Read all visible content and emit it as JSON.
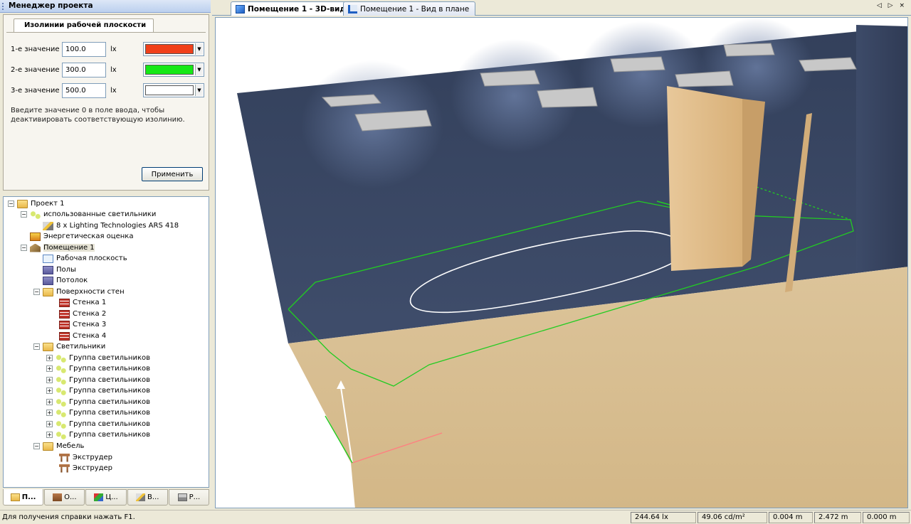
{
  "project_manager": {
    "title": "Менеджер проекта",
    "isolines_tab": "Изолинии рабочей плоскости",
    "rows": [
      {
        "label": "1-е значение",
        "value": "100.0",
        "unit": "lx",
        "color": "#f0401a"
      },
      {
        "label": "2-е значение",
        "value": "300.0",
        "unit": "lx",
        "color": "#16e816"
      },
      {
        "label": "3-е значение",
        "value": "500.0",
        "unit": "lx",
        "color": "#ffffff"
      }
    ],
    "note": "Введите значение 0 в поле ввода, чтобы деактивировать соответствующую изолинию.",
    "apply_label": "Применить"
  },
  "tree": {
    "project": "Проект 1",
    "used_luminaires": "использованные светильники",
    "luminaire": "8 x Lighting Technologies  ARS 418",
    "energy": "Энергетическая оценка",
    "room": "Помещение 1",
    "workplane": "Рабочая плоскость",
    "floors": "Полы",
    "ceiling": "Потолок",
    "wall_surfaces": "Поверхности стен",
    "walls": [
      "Стенка 1",
      "Стенка 2",
      "Стенка 3",
      "Стенка 4"
    ],
    "luminaires_folder": "Светильники",
    "groups": [
      "Группа светильников",
      "Группа светильников",
      "Группа светильников",
      "Группа светильников",
      "Группа светильников",
      "Группа светильников",
      "Группа светильников",
      "Группа светильников"
    ],
    "furniture": "Мебель",
    "furniture_items": [
      "Экструдер",
      "Экструдер"
    ]
  },
  "bottom_tabs": [
    "П...",
    "О...",
    "Ц...",
    "В...",
    "Р..."
  ],
  "doc_tabs": {
    "view3d": "Помещение 1 - 3D-вид",
    "plan": "Помещение 1 - Вид в плане",
    "nav": "◁ ▷ ×"
  },
  "status": {
    "help": "Для получения справки нажать F1.",
    "illuminance": "244.64 lx",
    "luminance": "49.06 cd/m²",
    "x": "0.004 m",
    "y": "2.472 m",
    "z": "0.000 m"
  },
  "colors": {
    "wall": "#3c4a66",
    "floor": "#d8bb8e",
    "iso_100": "#22cc22",
    "iso_300": "#ffffff"
  }
}
